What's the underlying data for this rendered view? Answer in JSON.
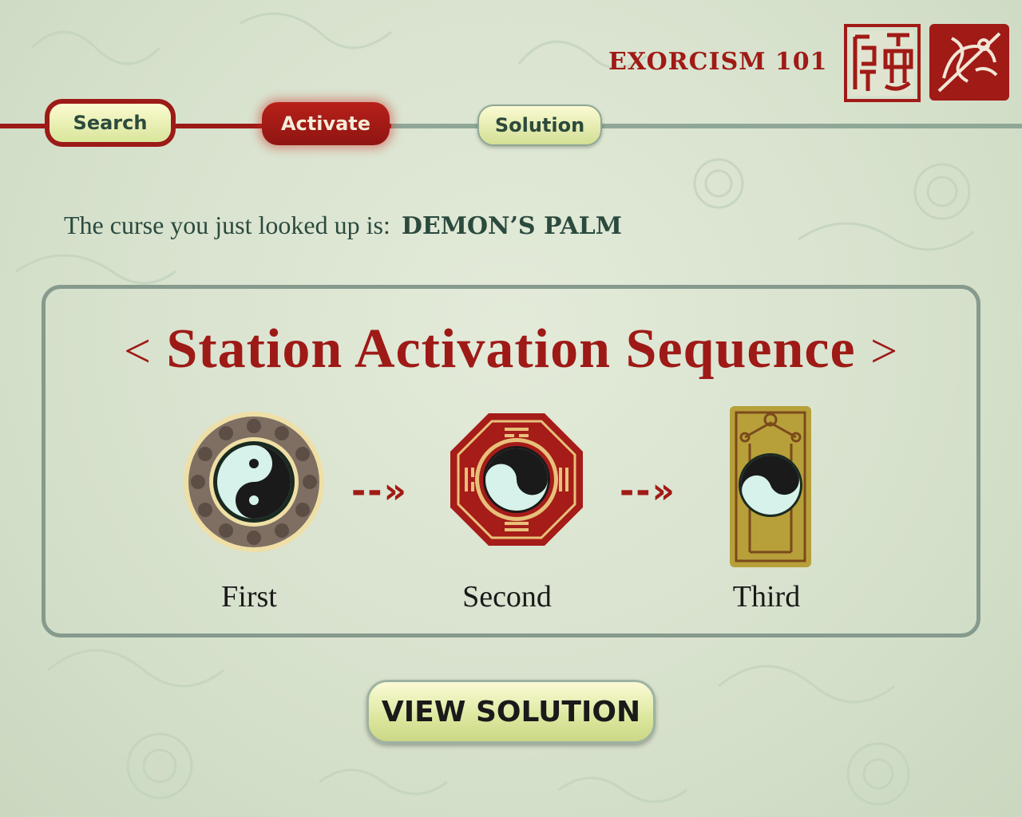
{
  "header": {
    "brand": "EXORCISM 101"
  },
  "steps": {
    "search": "Search",
    "activate": "Activate",
    "solution": "Solution"
  },
  "curse": {
    "prefix": "The curse you just looked up is:",
    "name": "DEMON’S PALM"
  },
  "panel": {
    "title": "Station Activation Sequence",
    "open_bracket": "<",
    "close_bracket": ">",
    "arrow": "--»",
    "stations": [
      {
        "label": "First",
        "icon": "round-disc-yin-yang-icon"
      },
      {
        "label": "Second",
        "icon": "octagon-bagua-yin-yang-icon"
      },
      {
        "label": "Third",
        "icon": "gold-plaque-yin-yang-icon"
      }
    ]
  },
  "view_button": {
    "label": "VIEW SOLUTION"
  },
  "colors": {
    "accent_red": "#9e1a17",
    "text_green": "#2b4a3e",
    "button_yellow": "#dce79e"
  }
}
